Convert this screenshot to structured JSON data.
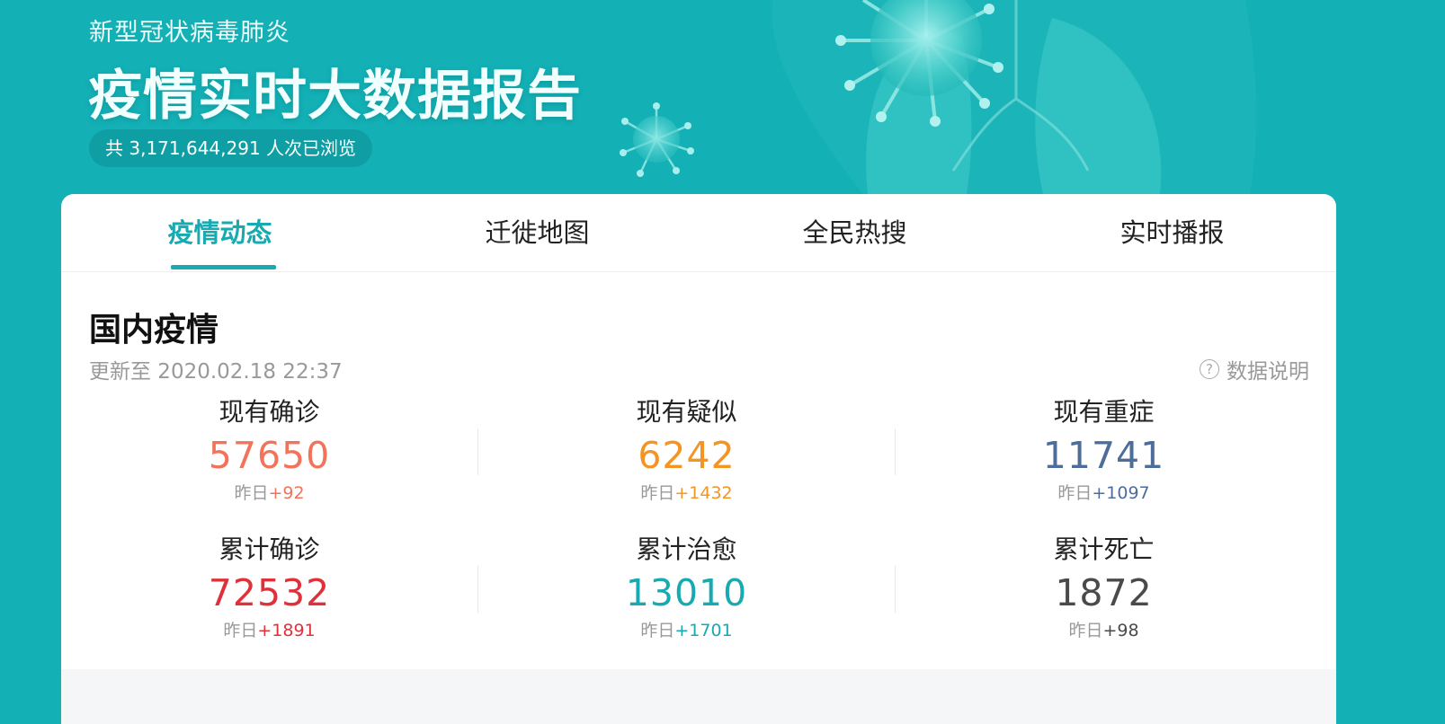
{
  "header": {
    "subtitle": "新型冠状病毒肺炎",
    "title": "疫情实时大数据报告",
    "views_text": "共 3,171,644,291 人次已浏览"
  },
  "tabs": [
    {
      "label": "疫情动态",
      "active": true
    },
    {
      "label": "迁徙地图",
      "active": false
    },
    {
      "label": "全民热搜",
      "active": false
    },
    {
      "label": "实时播报",
      "active": false
    }
  ],
  "section": {
    "title": "国内疫情",
    "update_time": "更新至 2020.02.18 22:37",
    "data_explain": "数据说明",
    "delta_prefix": "昨日"
  },
  "stats": [
    {
      "label": "现有确诊",
      "value": "57650",
      "delta": "+92",
      "color": "#f2735a"
    },
    {
      "label": "现有疑似",
      "value": "6242",
      "delta": "+1432",
      "color": "#f39424"
    },
    {
      "label": "现有重症",
      "value": "11741",
      "delta": "+1097",
      "color": "#4d6d9a"
    },
    {
      "label": "累计确诊",
      "value": "72532",
      "delta": "+1891",
      "color": "#e0313b"
    },
    {
      "label": "累计治愈",
      "value": "13010",
      "delta": "+1701",
      "color": "#17aab0"
    },
    {
      "label": "累计死亡",
      "value": "1872",
      "delta": "+98",
      "color": "#4a4a4a"
    }
  ],
  "colors": {
    "page_bg": "#13b0b5",
    "accent": "#17aab0"
  }
}
